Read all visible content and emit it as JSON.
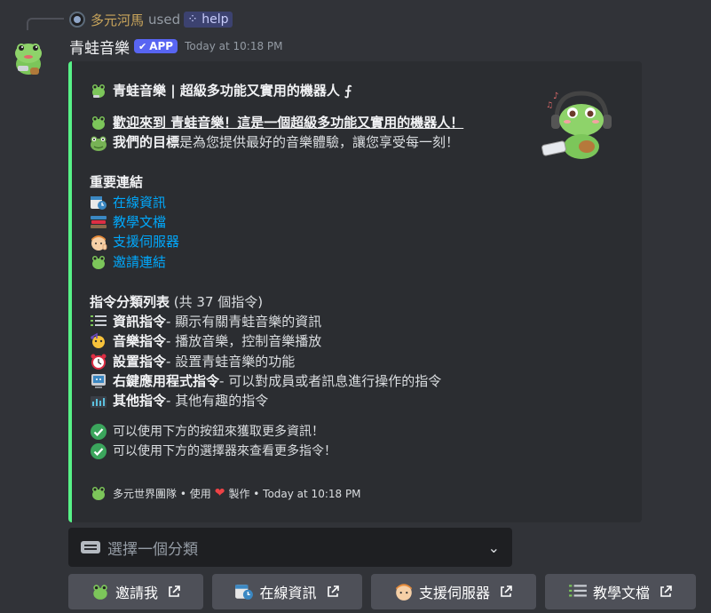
{
  "reply": {
    "username": "多元河馬",
    "used_text": "used",
    "command": "help"
  },
  "message": {
    "bot_name": "青蛙音樂",
    "app_badge": "APP",
    "timestamp": "Today at 10:18 PM"
  },
  "embed": {
    "accent_color": "#57f287",
    "title": "青蛙音樂 | 超級多功能又實用的機器人 ⨍",
    "welcome_line": "歡迎來到 青蛙音樂！這是一個超級多功能又實用的機器人！",
    "goal_bold": "我們的目標",
    "goal_rest": "是為您提供最好的音樂體驗，讓您享受每一刻！",
    "links_heading": "重要連結",
    "links": [
      {
        "icon": "calendar-clock-icon",
        "label": "在線資訊"
      },
      {
        "icon": "books-icon",
        "label": "教學文檔"
      },
      {
        "icon": "helper-face-icon",
        "label": "支援伺服器"
      },
      {
        "icon": "frog-icon",
        "label": "邀請連結"
      }
    ],
    "categories_heading": "指令分類列表",
    "categories_count": "(共 37 個指令)",
    "categories": [
      {
        "icon": "info-list-icon",
        "name": "資訊指令",
        "desc": " - 顯示有關青蛙音樂的資訊"
      },
      {
        "icon": "music-icon",
        "name": "音樂指令",
        "desc": " - 播放音樂，控制音樂播放"
      },
      {
        "icon": "alarm-clock-icon",
        "name": "設置指令",
        "desc": " - 設置青蛙音樂的功能"
      },
      {
        "icon": "context-menu-icon",
        "name": "右鍵應用程式指令",
        "desc": " - 可以對成員或者訊息進行操作的指令"
      },
      {
        "icon": "equalizer-icon",
        "name": "其他指令",
        "desc": " - 其他有趣的指令"
      }
    ],
    "notes": [
      "可以使用下方的按鈕來獲取更多資訊！",
      "可以使用下方的選擇器來查看更多指令！"
    ],
    "footer": {
      "team": "多元世界團隊 • 使用",
      "made": "製作 • Today at 10:18 PM"
    }
  },
  "select": {
    "placeholder": "選擇一個分類"
  },
  "buttons": [
    {
      "icon": "frog-icon",
      "label": "邀請我"
    },
    {
      "icon": "calendar-clock-icon",
      "label": "在線資訊"
    },
    {
      "icon": "helper-face-icon",
      "label": "支援伺服器"
    },
    {
      "icon": "info-list-icon",
      "label": "教學文檔"
    }
  ],
  "colors": {
    "background": "#313338",
    "embed_bg": "#2b2d31",
    "link": "#00a8fc",
    "app_badge": "#5865f2",
    "button": "#4e5058"
  }
}
